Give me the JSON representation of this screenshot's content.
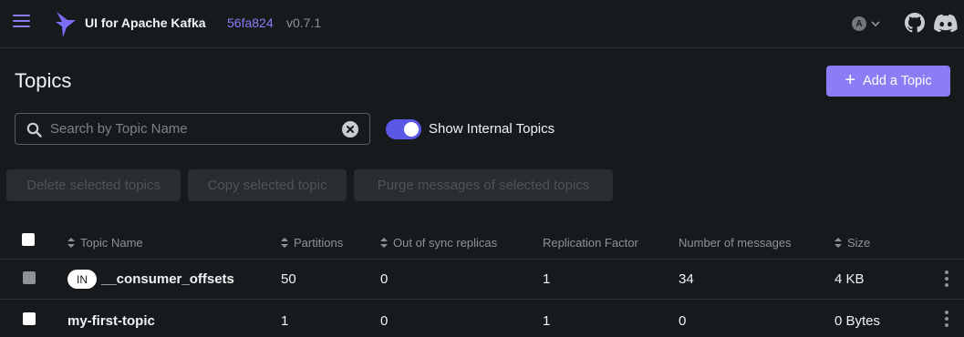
{
  "navbar": {
    "brand": "UI for Apache Kafka",
    "commit": "56fa824",
    "version": "v0.7.1",
    "user_initial": "A",
    "icons": [
      "menu-icon",
      "kafka-logo",
      "chevron-down-icon",
      "github-icon",
      "discord-icon"
    ]
  },
  "page": {
    "title": "Topics",
    "add_topic_label": "Add a Topic"
  },
  "search": {
    "placeholder": "Search by Topic Name",
    "value": ""
  },
  "toggle": {
    "label": "Show Internal Topics",
    "checked": true
  },
  "batch_actions": [
    "Delete selected topics",
    "Copy selected topic",
    "Purge messages of selected topics"
  ],
  "table": {
    "columns": [
      "Topic Name",
      "Partitions",
      "Out of sync replicas",
      "Replication Factor",
      "Number of messages",
      "Size"
    ],
    "rows": [
      {
        "badge": "IN",
        "name": "__consumer_offsets",
        "partitions": "50",
        "out_of_sync": "0",
        "replication": "1",
        "messages": "34",
        "size": "4 KB"
      },
      {
        "badge": "",
        "name": "my-first-topic",
        "partitions": "1",
        "out_of_sync": "0",
        "replication": "1",
        "messages": "0",
        "size": "0 Bytes"
      }
    ]
  },
  "colors": {
    "background": "#171a1c",
    "accent": "#8c7cf6",
    "toggle": "#5b58e8",
    "muted_text": "#8e9399"
  }
}
